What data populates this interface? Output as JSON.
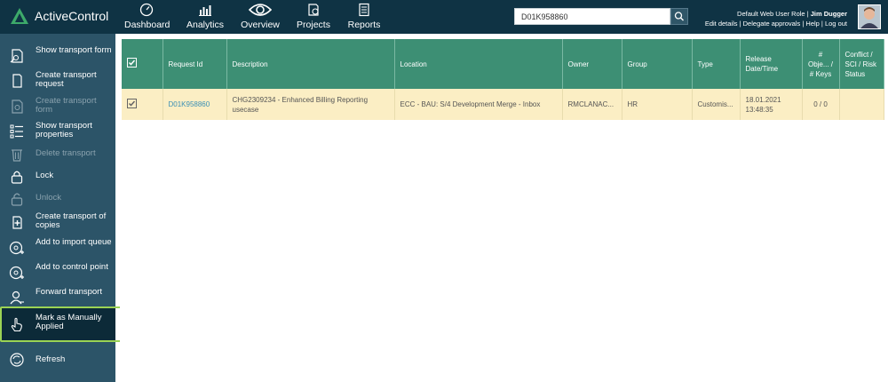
{
  "app": {
    "name": "ActiveControl"
  },
  "nav": [
    {
      "label": "Dashboard",
      "icon": "dashboard-icon"
    },
    {
      "label": "Analytics",
      "icon": "analytics-icon"
    },
    {
      "label": "Overview",
      "icon": "eye-icon"
    },
    {
      "label": "Projects",
      "icon": "projects-icon"
    },
    {
      "label": "Reports",
      "icon": "reports-icon"
    }
  ],
  "search": {
    "value": "D01K958860"
  },
  "user": {
    "role_prefix": "Default Web User Role | ",
    "name": "Jim Dugger",
    "links": [
      "Edit details",
      "Delegate approvals",
      "Help",
      "Log out"
    ]
  },
  "sidebar": {
    "items": [
      {
        "label": "Show transport form",
        "icon": "transport-form-icon",
        "enabled": true
      },
      {
        "label": "Create transport request",
        "icon": "create-request-icon",
        "enabled": true
      },
      {
        "label": "Create transport form",
        "icon": "create-form-icon",
        "enabled": false
      },
      {
        "label": "Show transport properties",
        "icon": "properties-icon",
        "enabled": true
      },
      {
        "label": "Delete transport",
        "icon": "trash-icon",
        "enabled": false
      },
      {
        "label": "Lock",
        "icon": "lock-icon",
        "enabled": true
      },
      {
        "label": "Unlock",
        "icon": "unlock-icon",
        "enabled": false
      },
      {
        "label": "Create transport of copies",
        "icon": "copies-icon",
        "enabled": true
      },
      {
        "label": "Add to import queue",
        "icon": "import-queue-icon",
        "enabled": true
      },
      {
        "label": "Add to control point",
        "icon": "control-point-icon",
        "enabled": true
      },
      {
        "label": "Forward transport",
        "icon": "forward-user-icon",
        "enabled": true
      },
      {
        "label": "Mark as Manually Applied",
        "icon": "hand-pointer-icon",
        "enabled": true
      },
      {
        "label": "Refresh",
        "icon": "refresh-icon",
        "enabled": true
      }
    ]
  },
  "table": {
    "headers": [
      "Request Id",
      "Description",
      "Location",
      "Owner",
      "Group",
      "Type",
      "Release Date/Time",
      "# Obje... / # Keys",
      "Conflict / SCI / Risk Status"
    ],
    "rows": [
      {
        "request_id": "D01K958860",
        "description": "CHG2309234 - Enhanced Billing Reporting usecase",
        "location": "ECC - BAU: S/4 Development Merge - Inbox",
        "owner": "RMCLANAC...",
        "group": "HR",
        "type": "Customis...",
        "release": "18.01.2021 13:48:35",
        "objects": "0 / 0",
        "conflict": ""
      }
    ]
  },
  "colors": {
    "topbar": "#0f3344",
    "sidebar": "#2c5468",
    "header": "#3d8f74",
    "row": "#fbeec4",
    "highlight": "#9bd354"
  }
}
